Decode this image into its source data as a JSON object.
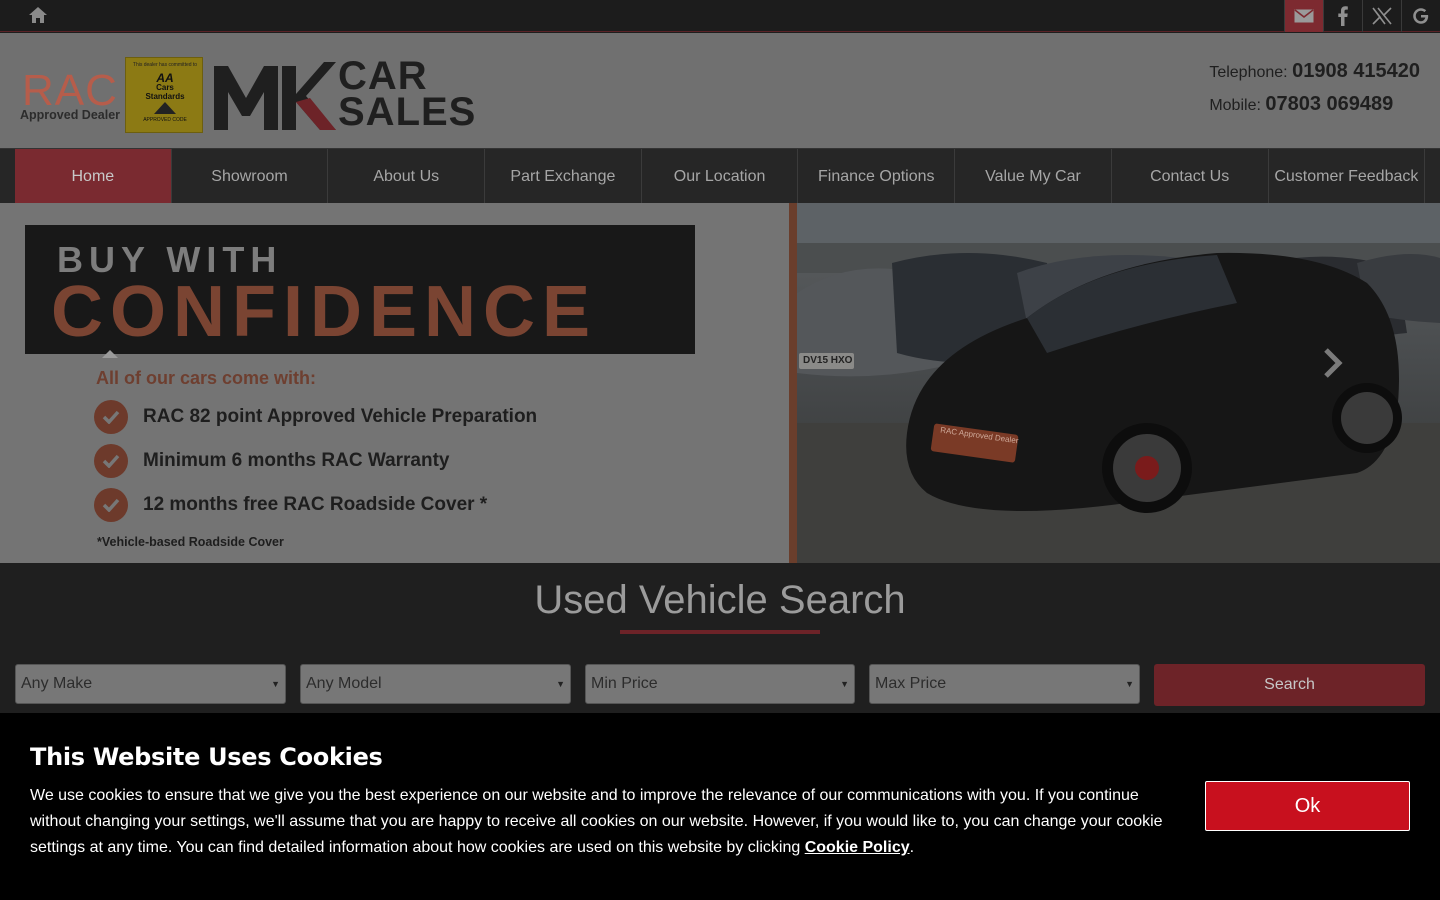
{
  "colors": {
    "accent": "#7a2a30",
    "cookie_button": "#c8101e",
    "dark_bar": "#1c1c1c"
  },
  "topbar": {
    "home_icon": "home-icon",
    "social": [
      "email-icon",
      "facebook-icon",
      "x-twitter-icon",
      "google-icon"
    ]
  },
  "header": {
    "rac_logo_text": "RAC",
    "rac_approved": "Approved Dealer",
    "aa_badge": {
      "top": "This dealer has committed to",
      "brand": "AA",
      "line1": "Cars",
      "line2": "Standards",
      "bottom": "APPROVED CODE"
    },
    "logo_line1": "CAR",
    "logo_line2": "SALES",
    "telephone_label": "Telephone:",
    "telephone": "01908 415420",
    "mobile_label": "Mobile:",
    "mobile": "07803 069489"
  },
  "nav": {
    "items": [
      {
        "label": "Home",
        "active": true
      },
      {
        "label": "Showroom"
      },
      {
        "label": "About Us"
      },
      {
        "label": "Part Exchange"
      },
      {
        "label": "Our Location"
      },
      {
        "label": "Finance Options"
      },
      {
        "label": "Value My Car"
      },
      {
        "label": "Contact Us"
      },
      {
        "label": "Customer Feedback"
      }
    ]
  },
  "hero": {
    "banner_line1": "BUY WITH",
    "banner_line2": "CONFIDENCE",
    "subheading": "All of our cars come with:",
    "features": [
      "RAC 82 point Approved Vehicle Preparation",
      "Minimum 6 months RAC Warranty",
      "12 months free RAC Roadside Cover *"
    ],
    "footnote": "*Vehicle-based Roadside Cover",
    "plate1": "DV15 HXO",
    "photo_badge": "RAC Approved Dealer"
  },
  "search": {
    "title": "Used Vehicle Search",
    "make": "Any Make",
    "model": "Any Model",
    "min_price": "Min Price",
    "max_price": "Max Price",
    "button": "Search"
  },
  "cookie": {
    "title": "This Website Uses Cookies",
    "text": "We use cookies to ensure that we give you the best experience on our website and to improve the relevance of our communications with you. If you continue without changing your settings, we'll assume that you are happy to receive all cookies on our website. However, if you would like to, you can change your cookie settings at any time. You can find detailed information about how cookies are used on this website by clicking ",
    "link": "Cookie Policy",
    "text_end": ".",
    "ok": "Ok"
  }
}
